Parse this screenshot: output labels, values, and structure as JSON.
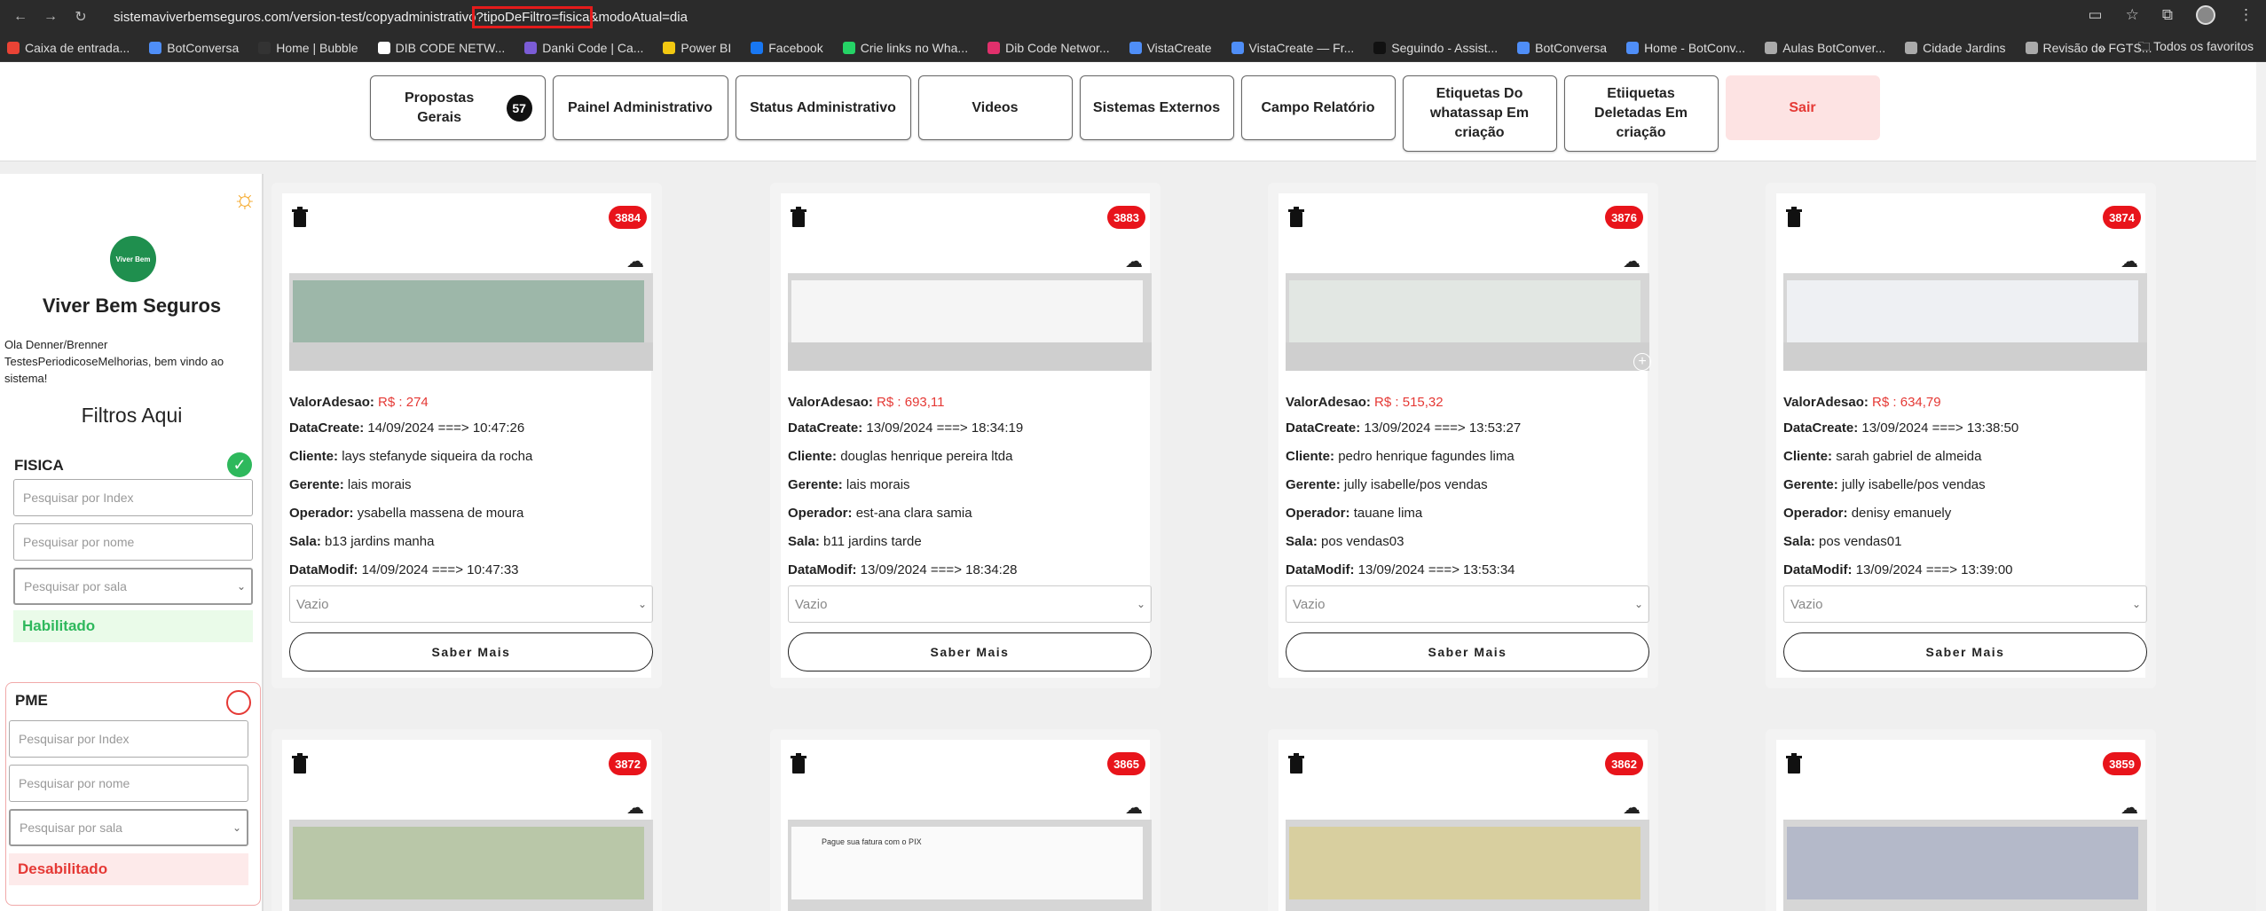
{
  "browser": {
    "url_prefix": "sistemaviverbemseguros.com/version-test/copyadministrativo",
    "url_highlight": "?tipoDeFiltro=fisica",
    "url_suffix": "&modoAtual=dia",
    "bookmarks": [
      {
        "label": "Caixa de entrada...",
        "color": "#ea4335"
      },
      {
        "label": "BotConversa",
        "color": "#4f8ef7"
      },
      {
        "label": "Home | Bubble",
        "color": "#333333"
      },
      {
        "label": "DIB CODE NETW...",
        "color": "#ffffff"
      },
      {
        "label": "Danki Code | Ca...",
        "color": "#7b5cd6"
      },
      {
        "label": "Power BI",
        "color": "#f2c811"
      },
      {
        "label": "Facebook",
        "color": "#1877f2"
      },
      {
        "label": "Crie links no Wha...",
        "color": "#25d366"
      },
      {
        "label": "Dib Code Networ...",
        "color": "#e1306c"
      },
      {
        "label": "VistaCreate",
        "color": "#4f8ef7"
      },
      {
        "label": "VistaCreate — Fr...",
        "color": "#4f8ef7"
      },
      {
        "label": "Seguindo - Assist...",
        "color": "#111111"
      },
      {
        "label": "BotConversa",
        "color": "#4f8ef7"
      },
      {
        "label": "Home - BotConv...",
        "color": "#4f8ef7"
      },
      {
        "label": "Aulas BotConver...",
        "color": "#aaaaaa"
      },
      {
        "label": "Cidade Jardins",
        "color": "#aaaaaa"
      },
      {
        "label": "Revisão do FGTS...",
        "color": "#aaaaaa"
      }
    ],
    "more": "»",
    "all_favorites": "Todos os favoritos"
  },
  "nav": {
    "buttons": [
      {
        "label": "Propostas Gerais",
        "badge": "57"
      },
      {
        "label": "Painel Administrativo"
      },
      {
        "label": "Status Administrativo"
      },
      {
        "label": "Videos"
      },
      {
        "label": "Sistemas Externos"
      },
      {
        "label": "Campo Relatório"
      },
      {
        "label": "Etiquetas Do whatassap Em criação"
      },
      {
        "label": "Etiiquetas Deletadas Em criação"
      }
    ],
    "sair": "Sair"
  },
  "sidebar": {
    "logo_text": "Viver Bem",
    "brand": "Viver Bem Seguros",
    "welcome": "Ola Denner/Brenner TestesPeriodicoseMelhorias, bem vindo ao sistema!",
    "filters_title": "Filtros Aqui",
    "fisica": {
      "title": "FISICA",
      "index_placeholder": "Pesquisar por Index",
      "nome_placeholder": "Pesquisar por nome",
      "sala_placeholder": "Pesquisar por sala",
      "status": "Habilitado"
    },
    "pme": {
      "title": "PME",
      "index_placeholder": "Pesquisar por Index",
      "nome_placeholder": "Pesquisar por nome",
      "sala_placeholder": "Pesquisar por sala",
      "status": "Desabilitado"
    }
  },
  "labels": {
    "valor": "ValorAdesao:",
    "datacreate": "DataCreate:",
    "cliente": "Cliente:",
    "gerente": "Gerente:",
    "operador": "Operador:",
    "sala": "Sala:",
    "datamodif": "DataModif:",
    "vazio": "Vazio",
    "saber": "Saber Mais"
  },
  "cards": [
    {
      "id": "3884",
      "valor": "R$ :  274",
      "datacreate": "14/09/2024  ===> 10:47:26",
      "cliente": "lays stefanyde siqueira da rocha",
      "gerente": "lais morais",
      "operador": "ysabella massena de moura",
      "sala": "b13 jardins manha",
      "datamodif": "14/09/2024  ===> 10:47:33"
    },
    {
      "id": "3883",
      "valor": "R$ :  693,11",
      "datacreate": "13/09/2024  ===> 18:34:19",
      "cliente": "douglas henrique pereira ltda",
      "gerente": "lais morais",
      "operador": "est-ana clara samia",
      "sala": "b11 jardins tarde",
      "datamodif": "13/09/2024  ===> 18:34:28"
    },
    {
      "id": "3876",
      "valor": "R$ :  515,32",
      "datacreate": "13/09/2024  ===> 13:53:27",
      "cliente": "pedro henrique fagundes lima",
      "gerente": "jully isabelle/pos vendas",
      "operador": "tauane lima",
      "sala": "pos vendas03",
      "datamodif": "13/09/2024  ===> 13:53:34"
    },
    {
      "id": "3874",
      "valor": "R$ :  634,79",
      "datacreate": "13/09/2024  ===> 13:38:50",
      "cliente": "sarah gabriel de almeida",
      "gerente": "jully isabelle/pos vendas",
      "operador": "denisy emanuely",
      "sala": "pos vendas01",
      "datamodif": "13/09/2024  ===> 13:39:00"
    },
    {
      "id": "3872"
    },
    {
      "id": "3865",
      "pix_text": "Pague sua fatura com o PIX"
    },
    {
      "id": "3862"
    },
    {
      "id": "3859"
    }
  ]
}
